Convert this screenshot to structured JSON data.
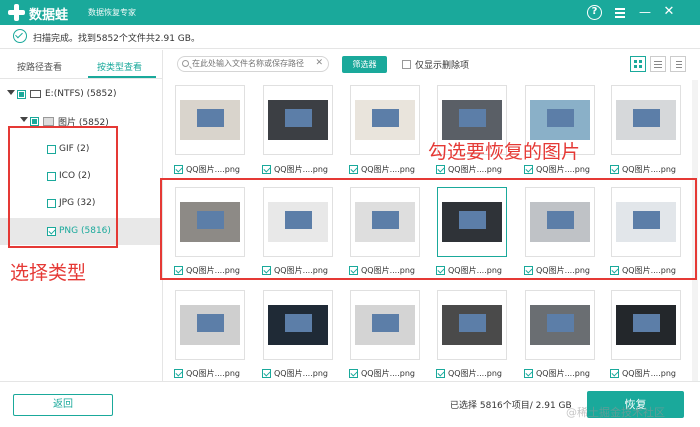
{
  "titlebar": {
    "app_name": "数据蛙",
    "subtitle": "数据恢复专家",
    "help": "?",
    "close": "✕",
    "minimize": "—"
  },
  "status": {
    "text": "扫描完成。找到5852个文件共2.91 GB。"
  },
  "left_panel": {
    "tabs": [
      {
        "label": "按路径查看",
        "active": false
      },
      {
        "label": "按类型查看",
        "active": true
      }
    ],
    "drive": {
      "label": "E:(NTFS) (5852)"
    },
    "folder": {
      "label": "图片 (5852)"
    },
    "types": [
      {
        "label": "GIF (2)",
        "checked": false
      },
      {
        "label": "ICO (2)",
        "checked": false
      },
      {
        "label": "JPG (32)",
        "checked": false
      },
      {
        "label": "PNG (5816)",
        "checked": true,
        "selected": true
      }
    ]
  },
  "toolbar": {
    "search_placeholder": "在此处输入文件名称或保存路径",
    "search_clear": "✕",
    "filter_label": "筛选器",
    "only_deleted_label": "仅显示删除项"
  },
  "grid": {
    "items": [
      {
        "caption": "QQ图片....png",
        "checked": true,
        "photo": "#d9d4cc"
      },
      {
        "caption": "QQ图片....png",
        "checked": true,
        "photo": "#3c3f44"
      },
      {
        "caption": "QQ图片....png",
        "checked": true,
        "photo": "#e9e4dc"
      },
      {
        "caption": "QQ图片....png",
        "checked": true,
        "photo": "#5a5f66"
      },
      {
        "caption": "QQ图片....png",
        "checked": true,
        "photo": "#8ab0c8"
      },
      {
        "caption": "QQ图片....png",
        "checked": true,
        "photo": "#d6d8da"
      },
      {
        "caption": "QQ图片....png",
        "checked": true,
        "photo": "#8d8a86"
      },
      {
        "caption": "QQ图片....png",
        "checked": true,
        "photo": "#e8e8e8"
      },
      {
        "caption": "QQ图片....png",
        "checked": true,
        "photo": "#dedede"
      },
      {
        "caption": "QQ图片....png",
        "checked": true,
        "photo": "#2f3338",
        "highlight": true
      },
      {
        "caption": "QQ图片....png",
        "checked": true,
        "photo": "#bfc2c6"
      },
      {
        "caption": "QQ图片....png",
        "checked": true,
        "photo": "#e2e6ea"
      },
      {
        "caption": "QQ图片....png",
        "checked": true,
        "photo": "#cfcfcf"
      },
      {
        "caption": "QQ图片....png",
        "checked": true,
        "photo": "#1f2a36"
      },
      {
        "caption": "QQ图片....png",
        "checked": true,
        "photo": "#d4d4d4"
      },
      {
        "caption": "QQ图片....png",
        "checked": true,
        "photo": "#4a4a4a"
      },
      {
        "caption": "QQ图片....png",
        "checked": true,
        "photo": "#6a6e72"
      },
      {
        "caption": "QQ图片....png",
        "checked": true,
        "photo": "#23272b"
      }
    ]
  },
  "annotations": {
    "select_type": "选择类型",
    "tick_pictures": "勾选要恢复的图片"
  },
  "footer": {
    "back_label": "返回",
    "selection_text": "已选择 5816个项目/ 2.91 GB",
    "recover_label": "恢复",
    "watermark": "@稀土掘金技术社区"
  },
  "colors": {
    "accent": "#1aa99b",
    "annotation": "#e53935"
  }
}
